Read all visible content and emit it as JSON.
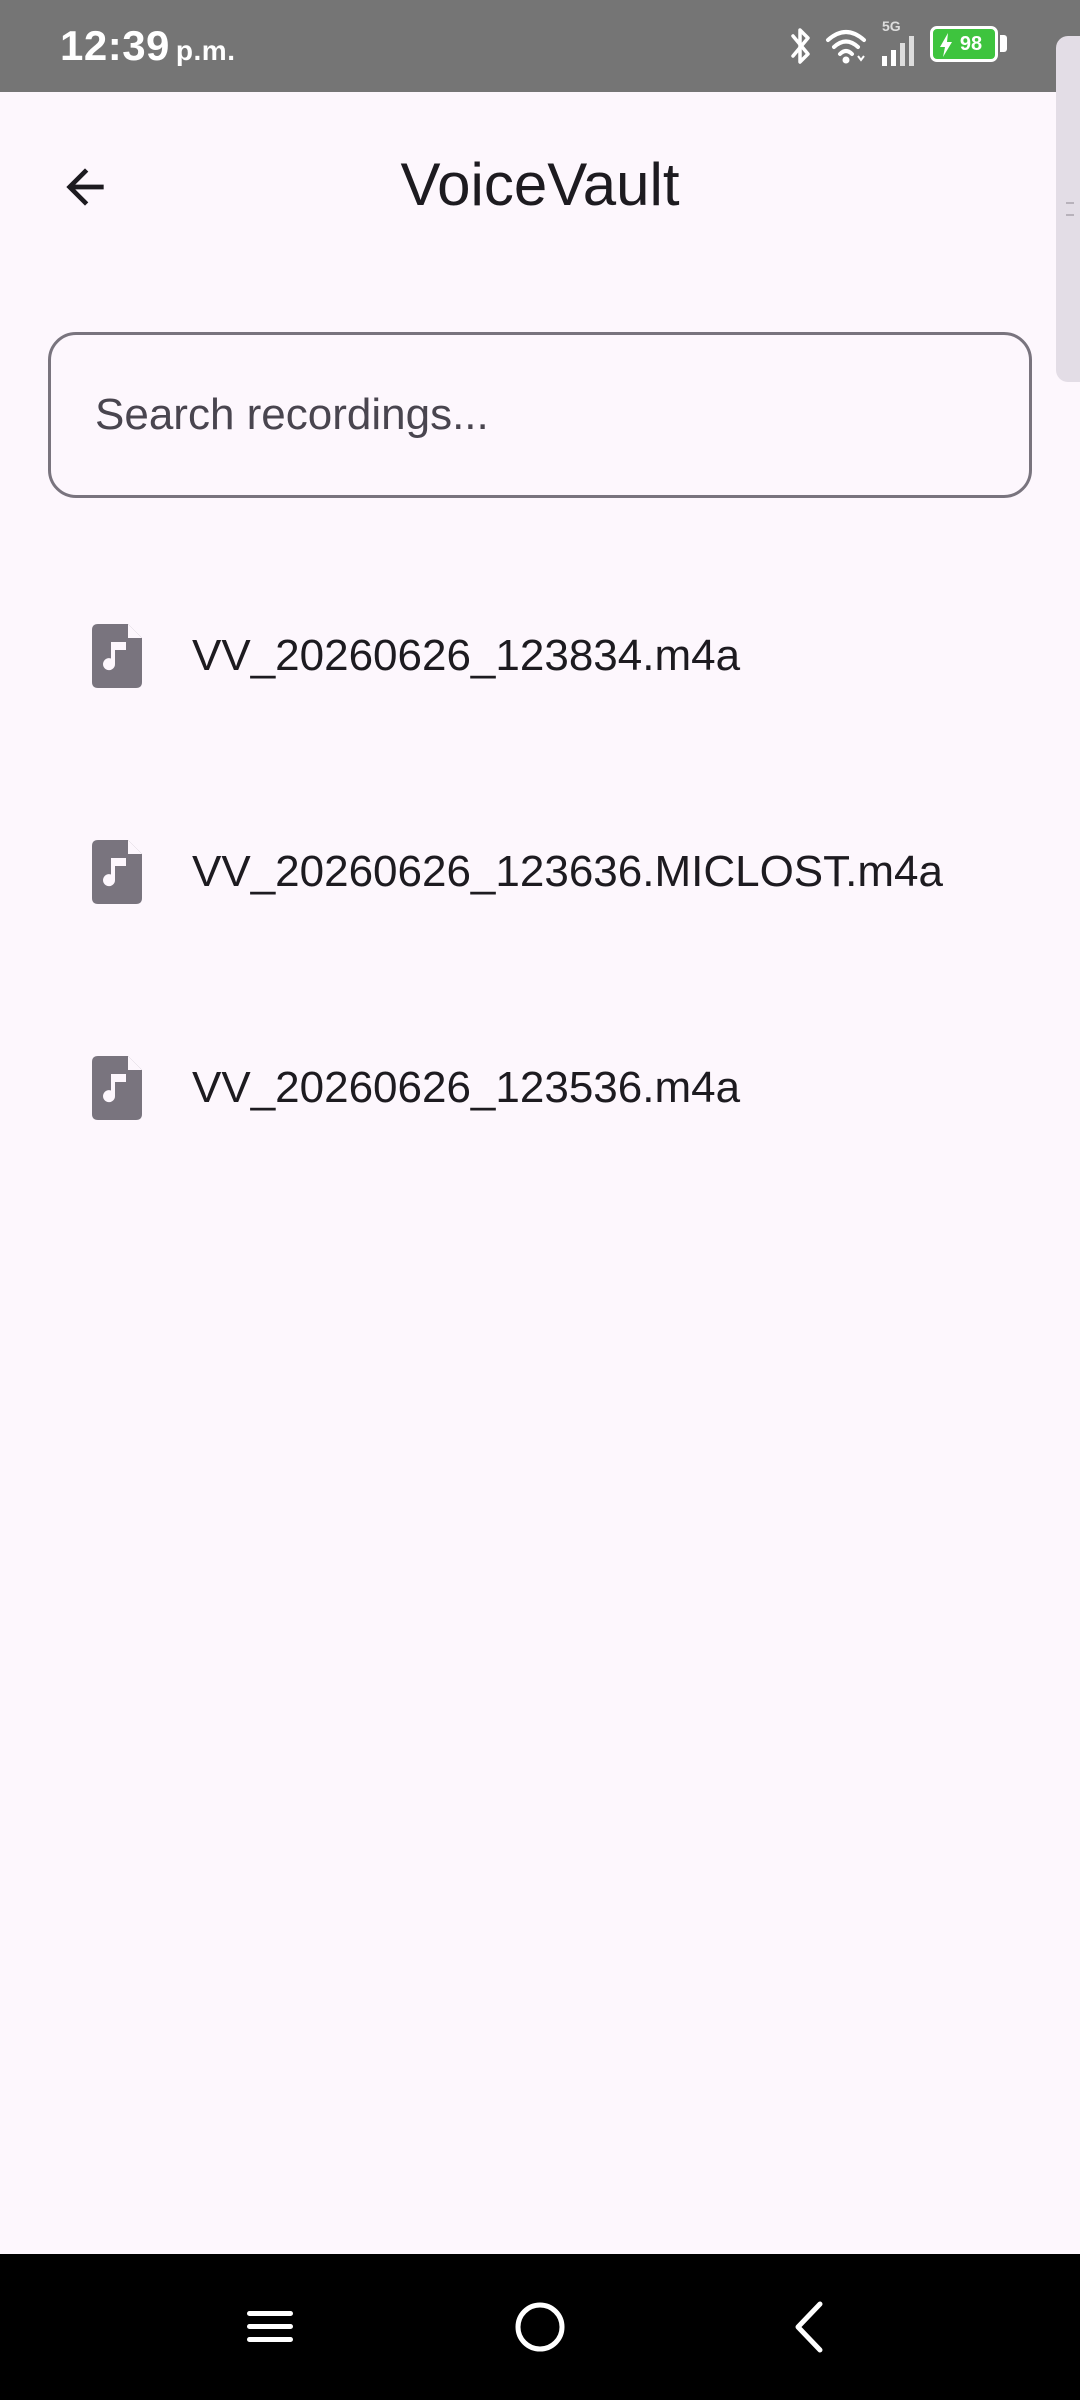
{
  "status_bar": {
    "time": "12:39",
    "ampm": "p.m.",
    "network": "5G",
    "battery": "98"
  },
  "app_bar": {
    "title": "VoiceVault"
  },
  "search": {
    "placeholder": "Search recordings...",
    "value": ""
  },
  "recordings": [
    {
      "name": "VV_20260626_123834.m4a"
    },
    {
      "name": "VV_20260626_123636.MICLOST.m4a"
    },
    {
      "name": "VV_20260626_123536.m4a"
    }
  ],
  "colors": {
    "background": "#fdf7fd",
    "status_bar": "#757575",
    "battery": "#3ec43e",
    "icon": "#79747e",
    "text": "#1d1b20"
  }
}
